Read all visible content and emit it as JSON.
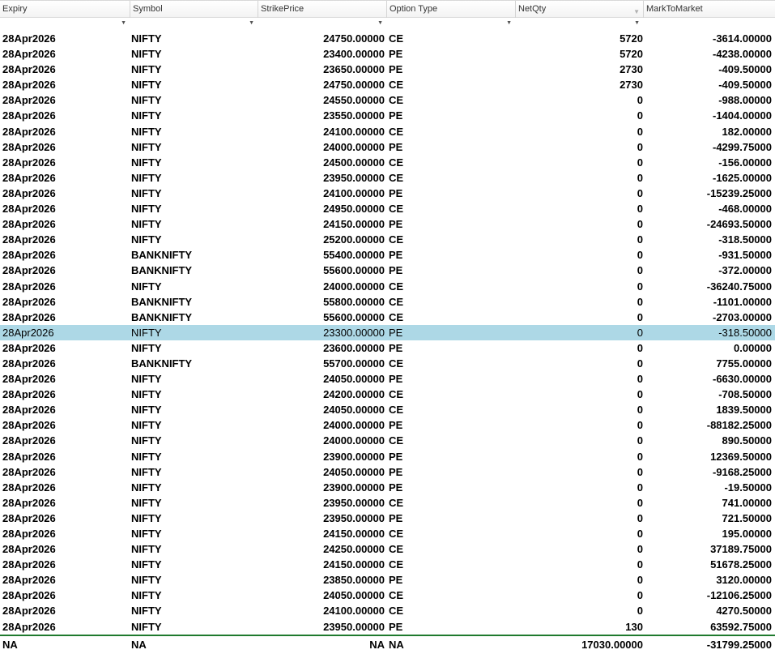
{
  "columns": [
    {
      "label": "Expiry"
    },
    {
      "label": "Symbol"
    },
    {
      "label": "StrikePrice"
    },
    {
      "label": "Option Type"
    },
    {
      "label": "NetQty"
    },
    {
      "label": "MarkToMarket"
    }
  ],
  "selected_row": 19,
  "rows": [
    {
      "expiry": "28Apr2026",
      "symbol": "NIFTY",
      "strike": "24750.00000",
      "opt": "CE",
      "qty": "5720",
      "mtm": "-3614.00000"
    },
    {
      "expiry": "28Apr2026",
      "symbol": "NIFTY",
      "strike": "23400.00000",
      "opt": "PE",
      "qty": "5720",
      "mtm": "-4238.00000"
    },
    {
      "expiry": "28Apr2026",
      "symbol": "NIFTY",
      "strike": "23650.00000",
      "opt": "PE",
      "qty": "2730",
      "mtm": "-409.50000"
    },
    {
      "expiry": "28Apr2026",
      "symbol": "NIFTY",
      "strike": "24750.00000",
      "opt": "CE",
      "qty": "2730",
      "mtm": "-409.50000"
    },
    {
      "expiry": "28Apr2026",
      "symbol": "NIFTY",
      "strike": "24550.00000",
      "opt": "CE",
      "qty": "0",
      "mtm": "-988.00000"
    },
    {
      "expiry": "28Apr2026",
      "symbol": "NIFTY",
      "strike": "23550.00000",
      "opt": "PE",
      "qty": "0",
      "mtm": "-1404.00000"
    },
    {
      "expiry": "28Apr2026",
      "symbol": "NIFTY",
      "strike": "24100.00000",
      "opt": "CE",
      "qty": "0",
      "mtm": "182.00000"
    },
    {
      "expiry": "28Apr2026",
      "symbol": "NIFTY",
      "strike": "24000.00000",
      "opt": "PE",
      "qty": "0",
      "mtm": "-4299.75000"
    },
    {
      "expiry": "28Apr2026",
      "symbol": "NIFTY",
      "strike": "24500.00000",
      "opt": "CE",
      "qty": "0",
      "mtm": "-156.00000"
    },
    {
      "expiry": "28Apr2026",
      "symbol": "NIFTY",
      "strike": "23950.00000",
      "opt": "CE",
      "qty": "0",
      "mtm": "-1625.00000"
    },
    {
      "expiry": "28Apr2026",
      "symbol": "NIFTY",
      "strike": "24100.00000",
      "opt": "PE",
      "qty": "0",
      "mtm": "-15239.25000"
    },
    {
      "expiry": "28Apr2026",
      "symbol": "NIFTY",
      "strike": "24950.00000",
      "opt": "CE",
      "qty": "0",
      "mtm": "-468.00000"
    },
    {
      "expiry": "28Apr2026",
      "symbol": "NIFTY",
      "strike": "24150.00000",
      "opt": "PE",
      "qty": "0",
      "mtm": "-24693.50000"
    },
    {
      "expiry": "28Apr2026",
      "symbol": "NIFTY",
      "strike": "25200.00000",
      "opt": "CE",
      "qty": "0",
      "mtm": "-318.50000"
    },
    {
      "expiry": "28Apr2026",
      "symbol": "BANKNIFTY",
      "strike": "55400.00000",
      "opt": "PE",
      "qty": "0",
      "mtm": "-931.50000"
    },
    {
      "expiry": "28Apr2026",
      "symbol": "BANKNIFTY",
      "strike": "55600.00000",
      "opt": "PE",
      "qty": "0",
      "mtm": "-372.00000"
    },
    {
      "expiry": "28Apr2026",
      "symbol": "NIFTY",
      "strike": "24000.00000",
      "opt": "CE",
      "qty": "0",
      "mtm": "-36240.75000"
    },
    {
      "expiry": "28Apr2026",
      "symbol": "BANKNIFTY",
      "strike": "55800.00000",
      "opt": "CE",
      "qty": "0",
      "mtm": "-1101.00000"
    },
    {
      "expiry": "28Apr2026",
      "symbol": "BANKNIFTY",
      "strike": "55600.00000",
      "opt": "CE",
      "qty": "0",
      "mtm": "-2703.00000"
    },
    {
      "expiry": "28Apr2026",
      "symbol": "NIFTY",
      "strike": "23300.00000",
      "opt": "PE",
      "qty": "0",
      "mtm": "-318.50000"
    },
    {
      "expiry": "28Apr2026",
      "symbol": "NIFTY",
      "strike": "23600.00000",
      "opt": "PE",
      "qty": "0",
      "mtm": "0.00000"
    },
    {
      "expiry": "28Apr2026",
      "symbol": "BANKNIFTY",
      "strike": "55700.00000",
      "opt": "CE",
      "qty": "0",
      "mtm": "7755.00000"
    },
    {
      "expiry": "28Apr2026",
      "symbol": "NIFTY",
      "strike": "24050.00000",
      "opt": "PE",
      "qty": "0",
      "mtm": "-6630.00000"
    },
    {
      "expiry": "28Apr2026",
      "symbol": "NIFTY",
      "strike": "24200.00000",
      "opt": "CE",
      "qty": "0",
      "mtm": "-708.50000"
    },
    {
      "expiry": "28Apr2026",
      "symbol": "NIFTY",
      "strike": "24050.00000",
      "opt": "CE",
      "qty": "0",
      "mtm": "1839.50000"
    },
    {
      "expiry": "28Apr2026",
      "symbol": "NIFTY",
      "strike": "24000.00000",
      "opt": "PE",
      "qty": "0",
      "mtm": "-88182.25000"
    },
    {
      "expiry": "28Apr2026",
      "symbol": "NIFTY",
      "strike": "24000.00000",
      "opt": "CE",
      "qty": "0",
      "mtm": "890.50000"
    },
    {
      "expiry": "28Apr2026",
      "symbol": "NIFTY",
      "strike": "23900.00000",
      "opt": "PE",
      "qty": "0",
      "mtm": "12369.50000"
    },
    {
      "expiry": "28Apr2026",
      "symbol": "NIFTY",
      "strike": "24050.00000",
      "opt": "PE",
      "qty": "0",
      "mtm": "-9168.25000"
    },
    {
      "expiry": "28Apr2026",
      "symbol": "NIFTY",
      "strike": "23900.00000",
      "opt": "PE",
      "qty": "0",
      "mtm": "-19.50000"
    },
    {
      "expiry": "28Apr2026",
      "symbol": "NIFTY",
      "strike": "23950.00000",
      "opt": "CE",
      "qty": "0",
      "mtm": "741.00000"
    },
    {
      "expiry": "28Apr2026",
      "symbol": "NIFTY",
      "strike": "23950.00000",
      "opt": "PE",
      "qty": "0",
      "mtm": "721.50000"
    },
    {
      "expiry": "28Apr2026",
      "symbol": "NIFTY",
      "strike": "24150.00000",
      "opt": "CE",
      "qty": "0",
      "mtm": "195.00000"
    },
    {
      "expiry": "28Apr2026",
      "symbol": "NIFTY",
      "strike": "24250.00000",
      "opt": "CE",
      "qty": "0",
      "mtm": "37189.75000"
    },
    {
      "expiry": "28Apr2026",
      "symbol": "NIFTY",
      "strike": "24150.00000",
      "opt": "CE",
      "qty": "0",
      "mtm": "51678.25000"
    },
    {
      "expiry": "28Apr2026",
      "symbol": "NIFTY",
      "strike": "23850.00000",
      "opt": "PE",
      "qty": "0",
      "mtm": "3120.00000"
    },
    {
      "expiry": "28Apr2026",
      "symbol": "NIFTY",
      "strike": "24050.00000",
      "opt": "CE",
      "qty": "0",
      "mtm": "-12106.25000"
    },
    {
      "expiry": "28Apr2026",
      "symbol": "NIFTY",
      "strike": "24100.00000",
      "opt": "CE",
      "qty": "0",
      "mtm": "4270.50000"
    },
    {
      "expiry": "28Apr2026",
      "symbol": "NIFTY",
      "strike": "23950.00000",
      "opt": "PE",
      "qty": "130",
      "mtm": "63592.75000"
    }
  ],
  "footer": {
    "expiry": "NA",
    "symbol": "NA",
    "strike": "NA",
    "opt": "NA",
    "qty": "17030.00000",
    "mtm": "-31799.25000"
  },
  "colors": {
    "selected_row": "#add8e6",
    "footer_rule": "#1f7a2e"
  }
}
